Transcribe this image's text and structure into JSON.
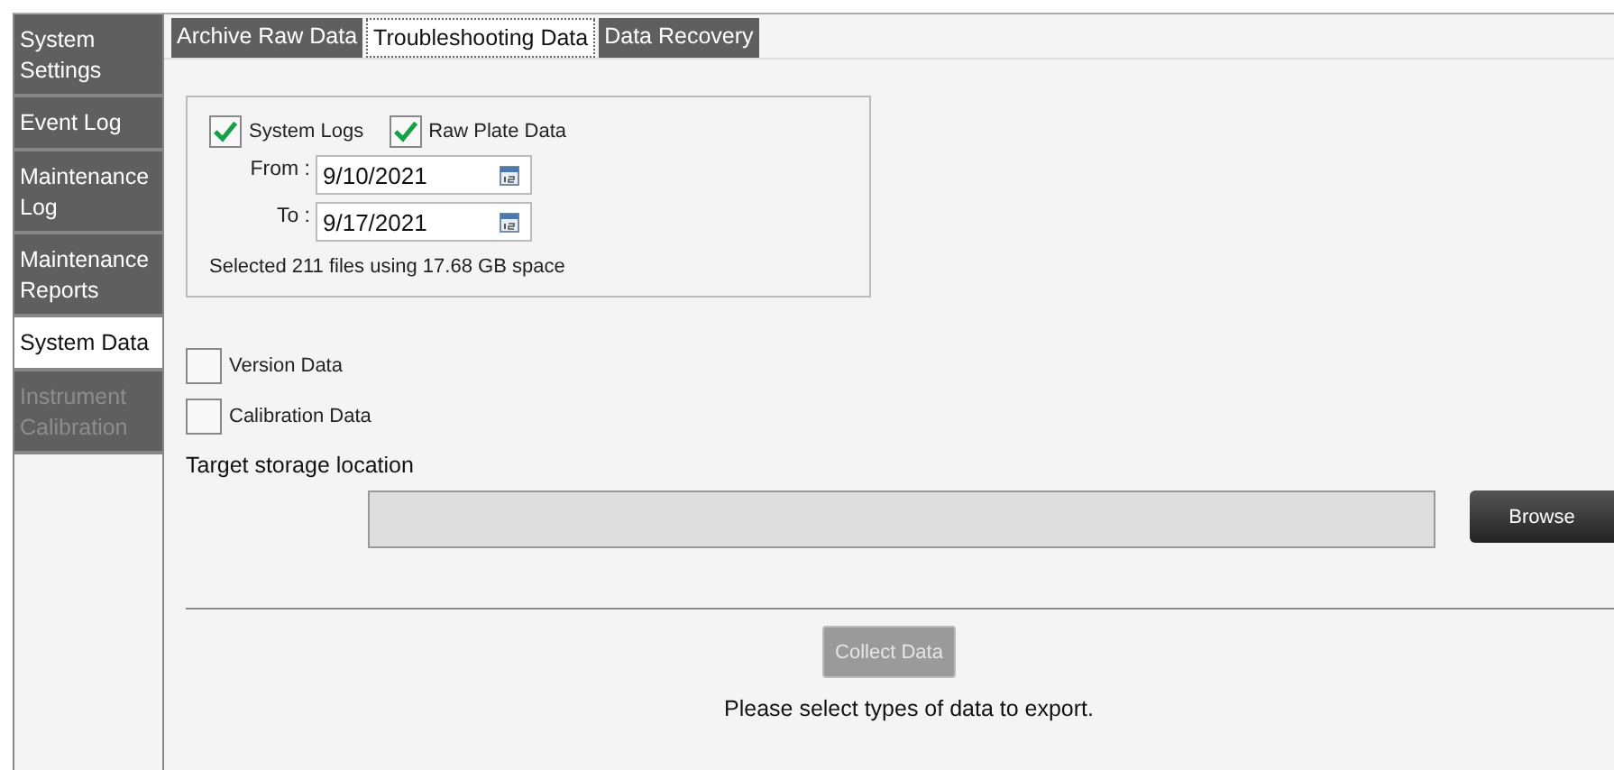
{
  "sidebar": {
    "items": [
      {
        "label": "System Settings",
        "selected": false,
        "disabled": false
      },
      {
        "label": "Event Log",
        "selected": false,
        "disabled": false
      },
      {
        "label": "Maintenance Log",
        "selected": false,
        "disabled": false
      },
      {
        "label": "Maintenance Reports",
        "selected": false,
        "disabled": false
      },
      {
        "label": "System Data",
        "selected": true,
        "disabled": false
      },
      {
        "label": "Instrument Calibration",
        "selected": false,
        "disabled": true
      }
    ]
  },
  "tabs": [
    {
      "label": "Archive Raw Data",
      "selected": false
    },
    {
      "label": "Troubleshooting Data",
      "selected": true
    },
    {
      "label": "Data Recovery",
      "selected": false
    }
  ],
  "troubleshooting": {
    "checkboxes": [
      {
        "label": "System Logs",
        "checked": true
      },
      {
        "label": "Raw Plate Data",
        "checked": true
      }
    ],
    "from": {
      "label": "From :",
      "value": "9/10/2021"
    },
    "to": {
      "label": "To :",
      "value": "9/17/2021"
    },
    "summary": "Selected 211 files using 17.68 GB space"
  },
  "extra_checkboxes": [
    {
      "label": "Version Data",
      "checked": false
    },
    {
      "label": "Calibration Data",
      "checked": false
    }
  ],
  "target": {
    "label": "Target storage location",
    "browse": "Browse"
  },
  "collect_button": {
    "label": "Collect Data",
    "disabled": true
  },
  "message": "Please select types of data to export."
}
